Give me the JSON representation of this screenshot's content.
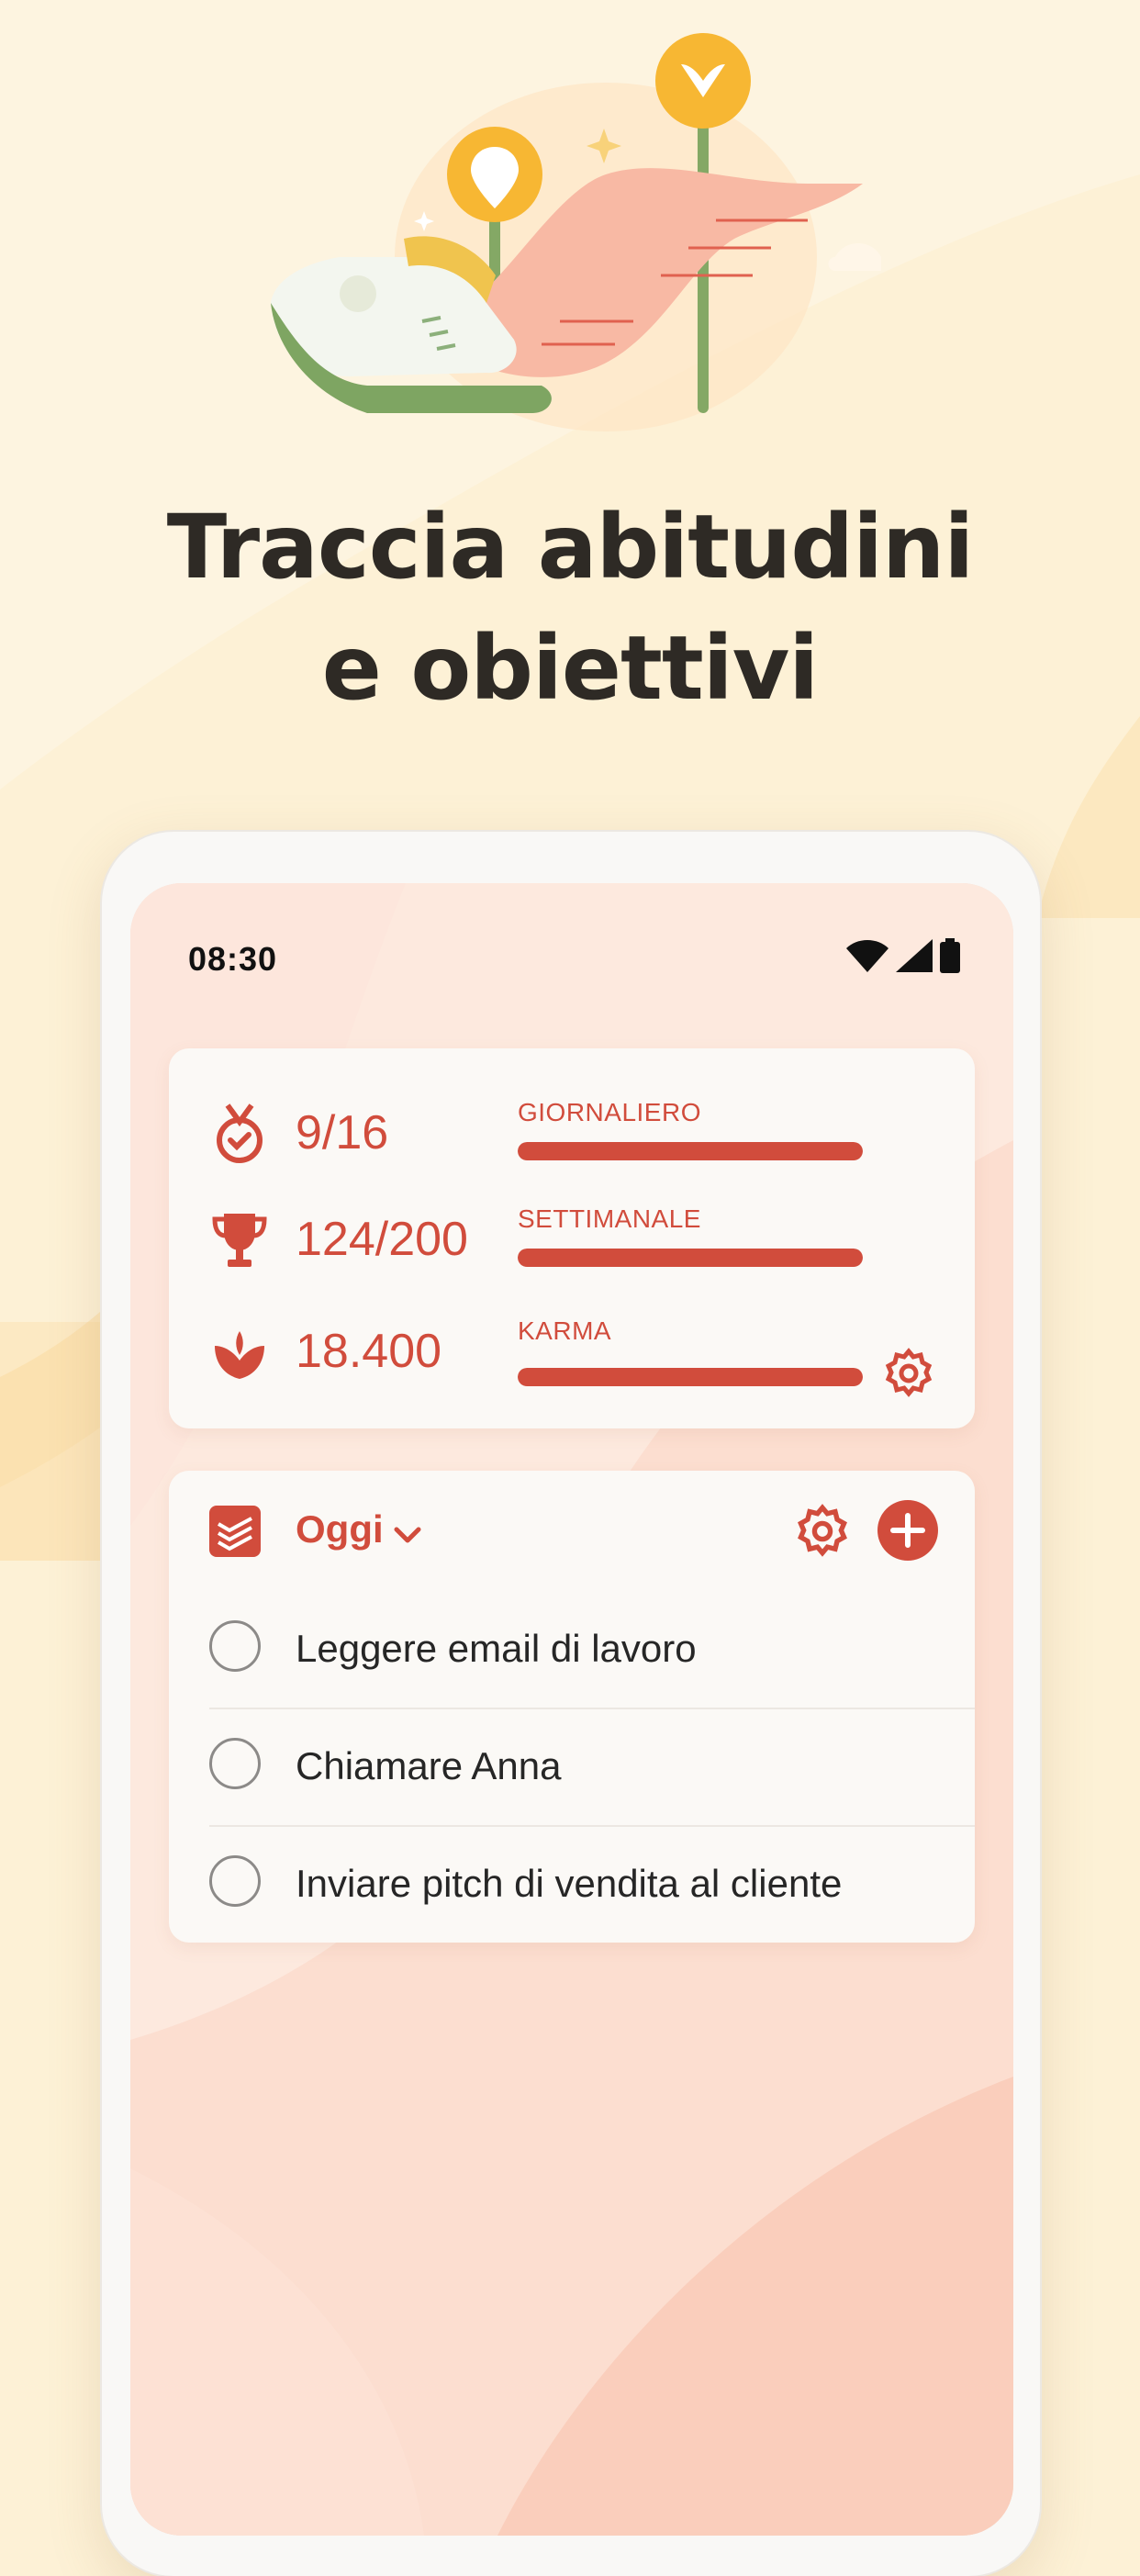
{
  "headline": {
    "line1": "Traccia abitudini",
    "line2": "e obiettivi"
  },
  "colors": {
    "accent": "#d14c3c",
    "background": "#fdf1d6",
    "card": "#fbf9f6"
  },
  "status_bar": {
    "time": "08:30",
    "icons": [
      "wifi-icon",
      "signal-icon",
      "battery-icon"
    ]
  },
  "stats": [
    {
      "icon": "medal-check-icon",
      "value": "9/16",
      "label": "GIORNALIERO",
      "progress": 1.0
    },
    {
      "icon": "trophy-icon",
      "value": "124/200",
      "label": "SETTIMANALE",
      "progress": 1.0
    },
    {
      "icon": "karma-lotus-icon",
      "value": "18.400",
      "label": "KARMA",
      "progress": 1.0
    }
  ],
  "tasks_widget": {
    "filter_label": "Oggi",
    "header_icons": [
      "todoist-logo-icon",
      "chevron-down-icon",
      "gear-icon",
      "add-icon"
    ],
    "tasks": [
      {
        "text": "Leggere email di lavoro"
      },
      {
        "text": "Chiamare Anna"
      },
      {
        "text": "Inviare pitch di vendita al cliente"
      }
    ]
  }
}
